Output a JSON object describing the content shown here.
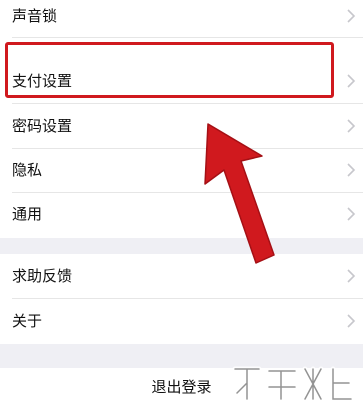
{
  "settings": {
    "group1": [
      {
        "label": "声音锁"
      },
      {
        "label": "支付设置"
      },
      {
        "label": "密码设置"
      },
      {
        "label": "隐私"
      },
      {
        "label": "通用"
      }
    ],
    "group2": [
      {
        "label": "求助反馈"
      },
      {
        "label": "关于"
      }
    ],
    "logout_label": "退出登录"
  },
  "annotation": {
    "highlight_color": "#d0191e",
    "arrow_color": "#d0191e"
  },
  "icons": {
    "row_chevron": "chevron-right-icon",
    "watermark": "watermark-logo"
  }
}
